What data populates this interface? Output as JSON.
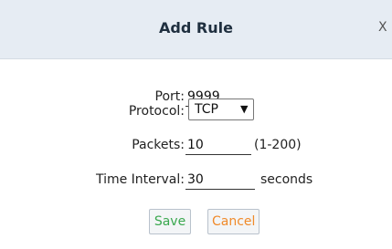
{
  "dialog": {
    "title": "Add Rule",
    "close_label": "X"
  },
  "form": {
    "port": {
      "label": "Port:",
      "value": "9999"
    },
    "protocol": {
      "label": "Protocol:",
      "selected": "TCP"
    },
    "packets": {
      "label": "Packets:",
      "value": "10",
      "hint": "(1-200)"
    },
    "interval": {
      "label": "Time Interval:",
      "value": "30",
      "unit": "seconds"
    }
  },
  "buttons": {
    "save_label": "Save",
    "cancel_label": "Cancel"
  },
  "colors": {
    "title_bar_bg": "#e6ecf3",
    "save_text": "#3aa84f",
    "cancel_text": "#f08a2a"
  },
  "icons": {
    "dropdown": "chevron-down-icon"
  }
}
